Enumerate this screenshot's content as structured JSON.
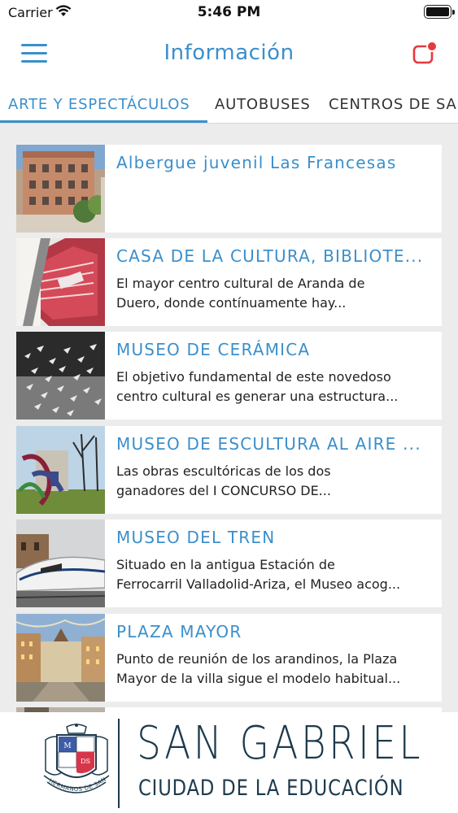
{
  "status_bar": {
    "carrier": "Carrier",
    "time": "5:46 PM",
    "icons": [
      "wifi-icon",
      "battery-icon"
    ]
  },
  "nav": {
    "title": "Información",
    "menu_icon": "hamburger-menu-icon",
    "notification_icon": "notification-icon",
    "accent_color": "#3b8fcb",
    "badge_color": "#e8383d"
  },
  "tabs": [
    {
      "label": "ARTE Y ESPECTÁCULOS",
      "active": true
    },
    {
      "label": "AUTOBUSES",
      "active": false
    },
    {
      "label": "CENTROS DE SA",
      "active": false
    }
  ],
  "items": [
    {
      "title": "Albergue juvenil Las Francesas",
      "desc_line1": "",
      "desc_line2": ""
    },
    {
      "title": "CASA DE LA CULTURA, BIBLIOTE...",
      "desc_line1": "El mayor centro cultural de Aranda de",
      "desc_line2": "Duero, donde contínuamente hay..."
    },
    {
      "title": "MUSEO DE CERÁMICA",
      "desc_line1": "El objetivo fundamental de este novedoso",
      "desc_line2": "centro cultural es generar una estructura..."
    },
    {
      "title": "MUSEO DE ESCULTURA AL AIRE ...",
      "desc_line1": "Las obras escultóricas de los dos",
      "desc_line2": "ganadores del I CONCURSO DE..."
    },
    {
      "title": "MUSEO DEL TREN",
      "desc_line1": "Situado en la antigua Estación de",
      "desc_line2": "Ferrocarril Valladolid-Ariza, el Museo acog..."
    },
    {
      "title": "PLAZA MAYOR",
      "desc_line1": "Punto de reunión de los arandinos, la Plaza",
      "desc_line2": "Mayor de la villa sigue el modelo habitual..."
    }
  ],
  "footer": {
    "brand_line1": "SAN GABRIEL",
    "brand_line2": "CIUDAD DE LA EDUCACIÓN",
    "crest_text": "HERMANOS DE SAN GABRIEL",
    "brand_color": "#1d3a4c"
  }
}
